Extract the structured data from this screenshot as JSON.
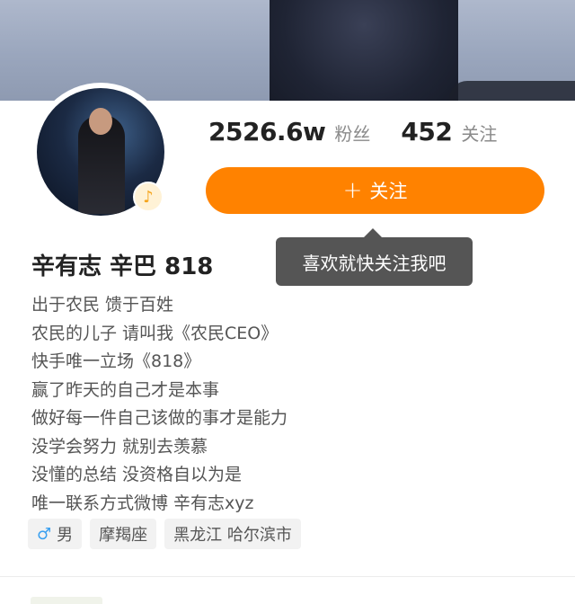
{
  "profile": {
    "name": "辛有志 辛巴 818",
    "fans_count": "2526.6w",
    "fans_label": "粉丝",
    "following_count": "452",
    "following_label": "关注",
    "avatar_badge_icon": "music-note-icon"
  },
  "follow_button": {
    "icon": "plus-icon",
    "label": "关注",
    "color": "#ff8200"
  },
  "tooltip": {
    "text": "喜欢就快关注我吧"
  },
  "bio": [
    "出于农民 馈于百姓",
    "农民的儿子 请叫我《农民CEO》",
    "快手唯一立场《818》",
    "赢了昨天的自己才是本事",
    "做好每一件自己该做的事才是能力",
    "没学会努力  就别去羡慕",
    "没懂的总结 没资格自以为是",
    "唯一联系方式微博  辛有志xyz"
  ],
  "tags": {
    "gender_icon": "male-icon",
    "gender": "男",
    "zodiac": "摩羯座",
    "location": "黑龙江 哈尔滨市"
  }
}
